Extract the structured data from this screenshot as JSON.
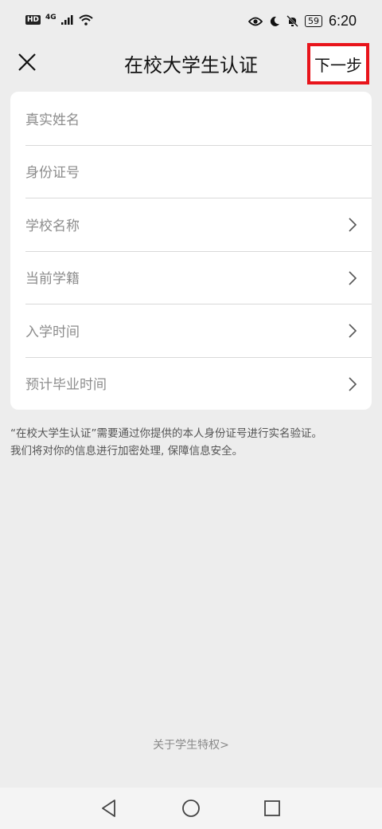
{
  "status_bar": {
    "network_label": "HD",
    "signal_label": "4G",
    "battery_level": "59",
    "time": "6:20"
  },
  "header": {
    "title": "在校大学生认证",
    "next_button": "下一步",
    "highlight_color": "#e8141b"
  },
  "form": {
    "rows": [
      {
        "label": "真实姓名",
        "has_chevron": false
      },
      {
        "label": "身份证号",
        "has_chevron": false
      },
      {
        "label": "学校名称",
        "has_chevron": true
      },
      {
        "label": "当前学籍",
        "has_chevron": true
      },
      {
        "label": "入学时间",
        "has_chevron": true
      },
      {
        "label": "预计毕业时间",
        "has_chevron": true
      }
    ]
  },
  "notice": {
    "line1": "“在校大学生认证”需要通过你提供的本人身份证号进行实名验证。",
    "line2": "我们将对你的信息进行加密处理, 保障信息安全。"
  },
  "footer": {
    "about_link": "关于学生特权>"
  },
  "icons": {
    "close": "close-icon",
    "chevron": "chevron-right-icon",
    "back": "nav-back-icon",
    "home": "nav-home-icon",
    "recents": "nav-recents-icon"
  }
}
